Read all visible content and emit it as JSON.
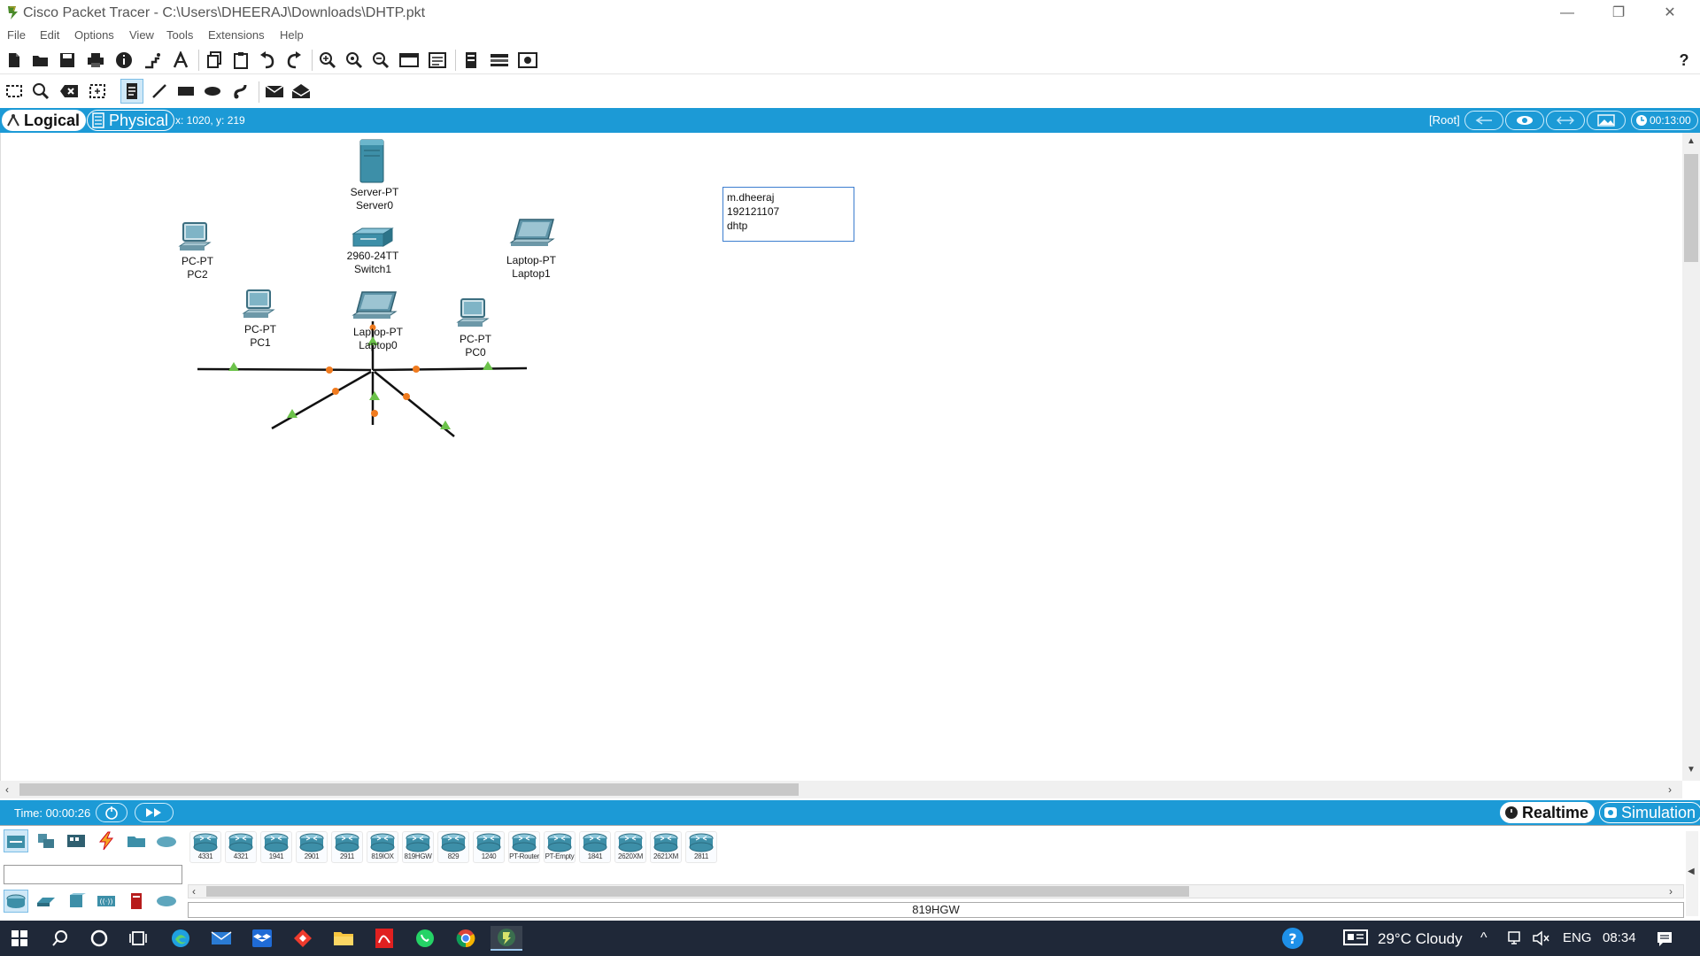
{
  "window": {
    "title": "Cisco Packet Tracer - C:\\Users\\DHEERAJ\\Downloads\\DHTP.pkt",
    "minimize": "—",
    "restore": "❐",
    "close": "✕"
  },
  "menu": [
    "File",
    "Edit",
    "Options",
    "View",
    "Tools",
    "Extensions",
    "Help"
  ],
  "toolbar_help": "?",
  "workspace_bar": {
    "logical": "Logical",
    "physical": "Physical",
    "coordinates": "x: 1020, y: 219",
    "root": "[Root]",
    "clock": "00:13:00"
  },
  "topology": {
    "devices": [
      {
        "id": "server0",
        "type_label": "Server-PT",
        "name": "Server0"
      },
      {
        "id": "switch1",
        "type_label": "2960-24TT",
        "name": "Switch1"
      },
      {
        "id": "pc2",
        "type_label": "PC-PT",
        "name": "PC2"
      },
      {
        "id": "laptop1",
        "type_label": "Laptop-PT",
        "name": "Laptop1"
      },
      {
        "id": "pc1",
        "type_label": "PC-PT",
        "name": "PC1"
      },
      {
        "id": "laptop0",
        "type_label": "Laptop-PT",
        "name": "Laptop0"
      },
      {
        "id": "pc0",
        "type_label": "PC-PT",
        "name": "PC0"
      }
    ],
    "note_lines": [
      "m.dheeraj",
      "192121107",
      "dhtp"
    ]
  },
  "timebar": {
    "time": "Time: 00:00:26",
    "realtime": "Realtime",
    "simulation": "Simulation"
  },
  "device_models": [
    "4331",
    "4321",
    "1941",
    "2901",
    "2911",
    "819IOX",
    "819HGW",
    "829",
    "1240",
    "PT-Router",
    "PT-Empty",
    "1841",
    "2620XM",
    "2621XM",
    "2811"
  ],
  "selected_model": "819HGW",
  "taskbar": {
    "weather": "29°C  Cloudy",
    "language": "ENG",
    "time": "08:34"
  },
  "colors": {
    "accent": "#1c9ad6",
    "link_up": "#6cc24a",
    "link_pending": "#f07b1f",
    "taskbar": "#1f2838"
  }
}
